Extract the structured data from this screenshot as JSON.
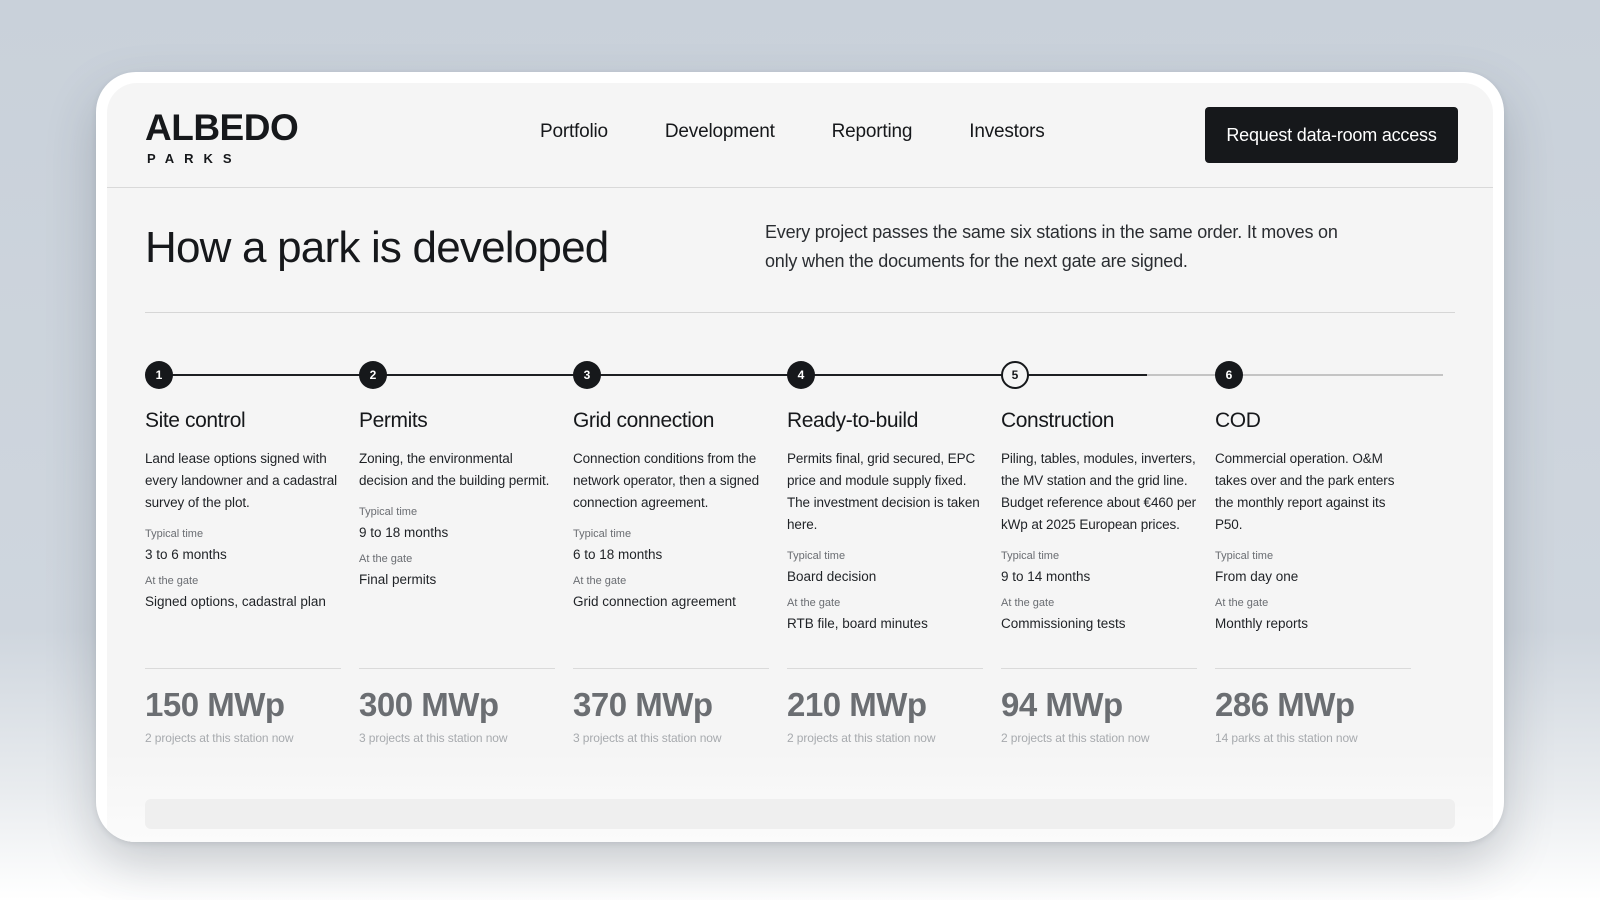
{
  "brand": {
    "name": "ALBEDO",
    "tagline": "PARKS"
  },
  "nav": {
    "links": [
      "Portfolio",
      "Development",
      "Reporting",
      "Investors"
    ],
    "cta_label": "Request data-room access"
  },
  "intro": {
    "title": "How a park is developed",
    "description": "Every project passes the same six stations in the same order. It moves on only when the documents for the next gate are signed."
  },
  "meta_labels": {
    "time": "Typical time",
    "gate": "At the gate"
  },
  "stages": [
    {
      "number": "1",
      "name": "Site control",
      "description": "Land lease options signed with every landowner and a cadastral survey of the plot.",
      "typical_time": "3 to 6 months",
      "gate": "Signed options, cadastral plan",
      "capacity": "150 MWp",
      "note": "2 projects at this station now",
      "current": false
    },
    {
      "number": "2",
      "name": "Permits",
      "description": "Zoning, the environmental decision and the building permit.",
      "typical_time": "9 to 18 months",
      "gate": "Final permits",
      "capacity": "300 MWp",
      "note": "3 projects at this station now",
      "current": false
    },
    {
      "number": "3",
      "name": "Grid connection",
      "description": "Connection conditions from the network operator, then a signed connection agreement.",
      "typical_time": "6 to 18 months",
      "gate": "Grid connection agreement",
      "capacity": "370 MWp",
      "note": "3 projects at this station now",
      "current": false
    },
    {
      "number": "4",
      "name": "Ready-to-build",
      "description": "Permits final, grid secured, EPC price and module supply fixed. The investment decision is taken here.",
      "typical_time": "Board decision",
      "gate": "RTB file, board minutes",
      "capacity": "210 MWp",
      "note": "2 projects at this station now",
      "current": false
    },
    {
      "number": "5",
      "name": "Construction",
      "description": "Piling, tables, modules, inverters, the MV station and the grid line. Budget reference about €460 per kWp at 2025 European prices.",
      "typical_time": "9 to 14 months",
      "gate": "Commissioning tests",
      "capacity": "94 MWp",
      "note": "2 projects at this station now",
      "current": true
    },
    {
      "number": "6",
      "name": "COD",
      "description": "Commercial operation. O&M takes over and the park enters the monthly report against its P50.",
      "typical_time": "From day one",
      "gate": "Monthly reports",
      "capacity": "286 MWp",
      "note": "14 parks at this station now",
      "current": false
    }
  ],
  "colors": {
    "ink": "#16181b",
    "stat": "#6b6e72",
    "muted": "#a7aaae",
    "background": "#f5f5f5"
  }
}
